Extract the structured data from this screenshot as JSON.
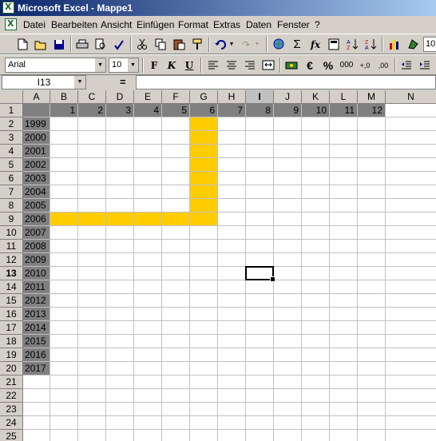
{
  "window": {
    "title": "Microsoft Excel - Mappe1"
  },
  "menu": [
    "Datei",
    "Bearbeiten",
    "Ansicht",
    "Einfügen",
    "Format",
    "Extras",
    "Daten",
    "Fenster",
    "?"
  ],
  "toolbar": {
    "font_name": "Arial",
    "font_size": "10",
    "zoom_partial": "10",
    "sum_glyph": "Σ",
    "fx_glyph": "fx",
    "bold": "F",
    "italic": "K",
    "underline": "U",
    "euro": "€",
    "percent": "%",
    "thousands": "000",
    "inc_decimal": "+,0",
    "dec_decimal": ",00"
  },
  "formula_bar": {
    "name_box": "I13",
    "equals": "=",
    "value": ""
  },
  "sheet": {
    "columns": [
      "A",
      "B",
      "C",
      "D",
      "E",
      "F",
      "G",
      "H",
      "I",
      "J",
      "K",
      "L",
      "M",
      "N"
    ],
    "active_column": "I",
    "active_row": 13,
    "rows": [
      "1",
      "2",
      "3",
      "4",
      "5",
      "6",
      "7",
      "8",
      "9",
      "10",
      "11",
      "12",
      "13",
      "14",
      "15",
      "16",
      "17",
      "18",
      "19",
      "20",
      "21",
      "22",
      "23",
      "24",
      "25"
    ],
    "row1_values": [
      "1",
      "2",
      "3",
      "4",
      "5",
      "6",
      "7",
      "8",
      "9",
      "10",
      "11",
      "12"
    ],
    "years": [
      "1999",
      "2000",
      "2001",
      "2002",
      "2003",
      "2004",
      "2005",
      "2006",
      "2007",
      "2008",
      "2009",
      "2010",
      "2011",
      "2012",
      "2013",
      "2014",
      "2015",
      "2016",
      "2017"
    ],
    "header_fill": "#808080",
    "highlight_fill": "#ffcc00"
  }
}
